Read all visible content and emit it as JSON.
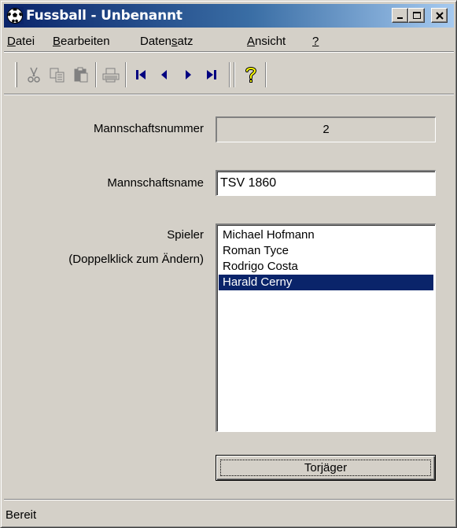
{
  "window": {
    "title": "Fussball - Unbenannt",
    "title_color": "#ffffff",
    "titlebar_gradient_start": "#0a246a",
    "titlebar_gradient_end": "#a6caf0"
  },
  "menu": {
    "items": [
      {
        "label": "Datei",
        "accel_index": 0
      },
      {
        "label": "Bearbeiten",
        "accel_index": 0
      },
      {
        "label": "Datensatz",
        "accel_index": 5
      },
      {
        "label": "Ansicht",
        "accel_index": 0
      },
      {
        "label": "?",
        "accel_index": 0
      }
    ]
  },
  "toolbar": {
    "buttons": [
      {
        "name": "cut-icon",
        "enabled": false
      },
      {
        "name": "copy-icon",
        "enabled": false
      },
      {
        "name": "paste-icon",
        "enabled": false
      },
      {
        "name": "print-icon",
        "enabled": false
      },
      {
        "name": "first-record-icon",
        "enabled": true
      },
      {
        "name": "previous-record-icon",
        "enabled": true
      },
      {
        "name": "next-record-icon",
        "enabled": true
      },
      {
        "name": "last-record-icon",
        "enabled": true
      },
      {
        "name": "help-icon",
        "enabled": true
      }
    ],
    "nav_color": "#000080"
  },
  "form": {
    "team_number_label": "Mannschaftsnummer",
    "team_number_value": "2",
    "team_name_label": "Mannschaftsname",
    "team_name_value": "TSV 1860",
    "players_label": "Spieler",
    "players_hint": "(Doppelklick zum Ändern)",
    "players": [
      {
        "name": "Michael Hofmann",
        "selected": false
      },
      {
        "name": "Roman Tyce",
        "selected": false
      },
      {
        "name": "Rodrigo Costa",
        "selected": false
      },
      {
        "name": "Harald Cerny",
        "selected": true
      }
    ],
    "selection_color": "#0a246a",
    "top_scorer_button": "Torjäger"
  },
  "status": {
    "text": "Bereit"
  }
}
